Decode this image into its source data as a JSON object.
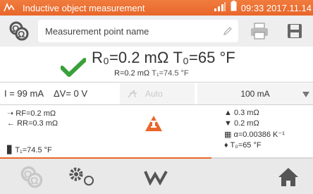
{
  "status_bar": {
    "title": "Inductive object measurement",
    "clock": "09:33 2017.11.14"
  },
  "toolbar": {
    "point_name_placeholder": "Measurement point name"
  },
  "result": {
    "main_r0": "R₀=0.2 mΩ",
    "main_t0": "T₀=65 °F",
    "sub_r": "R=0.2 mΩ",
    "sub_t1": "T₁=74.5 °F"
  },
  "params": {
    "current": "I = 99 mA",
    "delta_v": "ΔV= 0 V",
    "auto_label": "Auto",
    "current_select_value": "100 mA"
  },
  "details": {
    "rf": "Rₙ=0.2 mΩ",
    "rf_label": "RF=0.2 mΩ",
    "rr_label": "RR=0.3 mΩ",
    "t1": "T₁=74.5 °F",
    "r_up": "0.3 mΩ",
    "r_down": "0.2 mΩ",
    "alpha": "α=0.00386 K⁻¹",
    "t0": "T₀=65 °F"
  },
  "colors": {
    "accent": "#e8672a",
    "check": "#3aa03a",
    "icon_gray": "#555555"
  },
  "icons": {
    "app": "inductive-object-icon",
    "signal": "signal-icon",
    "battery": "battery-icon",
    "pencil": "pencil-icon",
    "print": "print-icon",
    "save": "save-icon",
    "check": "check-icon",
    "warning": "warning-icon",
    "home": "home-icon",
    "settings": "settings-icon",
    "graph": "graph-icon"
  }
}
